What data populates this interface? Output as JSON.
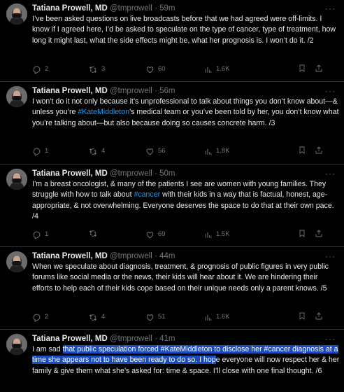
{
  "author": {
    "name": "Tatiana Prowell, MD",
    "handle": "@tmprowell",
    "separator": "·",
    "more_label": "···"
  },
  "tweets": [
    {
      "time": "59m",
      "text": [
        {
          "t": "I’ve been asked questions on live broadcasts before that we had agreed were off-limits. I know if I agreed here, I’d be asked to speculate on the type of cancer, type of treatment, how long it might last, what the side effects might be, what her prognosis is. I won’t do it. /2"
        }
      ],
      "replies": "2",
      "reposts": "3",
      "likes": "60",
      "views": "1.6K"
    },
    {
      "time": "56m",
      "text": [
        {
          "t": "I won’t do it not only because it’s unprofessional to talk about things you don’t know about—& unless you’re "
        },
        {
          "t": "#KateMiddleton",
          "style": "hashtag"
        },
        {
          "t": "’s medical team or you’ve been told by her, you don’t know what you’re talking about—but also because doing so causes concrete harm. /3"
        }
      ],
      "replies": "1",
      "reposts": "4",
      "likes": "56",
      "views": "1.8K"
    },
    {
      "time": "50m",
      "text": [
        {
          "t": "I’m a breast oncologist, & many of the patients I see are women with young families. They struggle with how to talk about "
        },
        {
          "t": "#cancer",
          "style": "hashtag"
        },
        {
          "t": " with their kids in a way that is factual, honest, age-appropriate, & not overwhelming. Everyone deserves the space to do that at their own pace. /4"
        }
      ],
      "replies": "1",
      "reposts": "",
      "likes": "69",
      "views": "1.5K"
    },
    {
      "time": "44m",
      "text": [
        {
          "t": "When we speculate about diagnosis, treatment, & prognosis of public figures in very public forums like social media or the news, their kids will hear about it. We are hindering their efforts to help each of their kids cope based on their unique needs only a parent knows. /5"
        }
      ],
      "replies": "2",
      "reposts": "4",
      "likes": "51",
      "views": "1.6K"
    },
    {
      "time": "41m",
      "text": [
        {
          "t": "I am sad "
        },
        {
          "t": "that public speculation forced #KateMiddleton to disclose her #cancer diagnosis at a time she appears not to have been ready to do so. I hop",
          "style": "hl"
        },
        {
          "t": "e everyone will now respect her & her family & give them what she’s asked for: time & space. I’ll close with one final thought. /6"
        }
      ]
    }
  ],
  "colors": {
    "background": "#000000",
    "text": "#e7e9ea",
    "muted": "#71767b",
    "link": "#1d9bf0",
    "selection": "#1a4bb8",
    "divider": "#2f3336"
  },
  "icons": {
    "reply": "reply-icon",
    "repost": "repost-icon",
    "like": "like-icon",
    "views": "views-icon",
    "bookmark": "bookmark-icon",
    "share": "share-icon"
  }
}
